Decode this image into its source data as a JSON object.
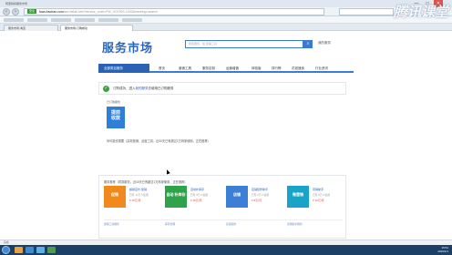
{
  "window": {
    "title": "阿里妈妈服务市场",
    "controls": [
      "—",
      "□",
      "✕"
    ]
  },
  "browser": {
    "secure_label": "安全",
    "url_domain": "fuwu.taobao.com",
    "url_rest": "/ser/detail.htm?service_code=FW_GOODS-1000&tracelog=search",
    "tabs": [
      {
        "label": "服务市场-淘宝",
        "active": false
      },
      {
        "label": "服务市场-订购成功",
        "active": true
      }
    ]
  },
  "watermark": "腾讯课堂",
  "header": {
    "logo": "服务市场",
    "logo_sub": "FUWU.TAOBAO.COM",
    "search_placeholder": "搜索服务，如:促销工具",
    "my_service": "我的服务"
  },
  "nav": {
    "category_button": "全部类目服务",
    "items": [
      "首页",
      "营销工具",
      "服务定制",
      "运营增值",
      "体验版",
      "排行榜",
      "花钱速卖",
      "行业资讯"
    ]
  },
  "notice": {
    "text_prefix": "订购成功，进入",
    "link": "我的服务",
    "text_suffix": "去使用已订购服务"
  },
  "service_card": {
    "label": "已订购服务",
    "icon_line1": "提前",
    "icon_line2": "收款",
    "description": "你可能也需要（高效营销、运营工具，近30天已有超过1万商家使用，正在推荐）"
  },
  "recommendations": {
    "title": "服务推荐（同类服务，近30天已有超过1万商家使用，正在推荐）",
    "items": [
      {
        "thumb": "促销",
        "name": "超级店长-促销",
        "meta": "已有 12万人使用",
        "price": "¥ 15元/月",
        "color": "#f08a1c"
      },
      {
        "thumb": "自动\n补库存",
        "name": "自动补库存",
        "meta": "已有 8万人使用",
        "price": "¥ 10元/月",
        "color": "#2fa34a"
      },
      {
        "thumb": "店铺",
        "name": "店铺装修助手",
        "meta": "已有 6万人使用",
        "price": "¥ 9元/月",
        "color": "#3d7fd6"
      },
      {
        "thumb": "微营销",
        "name": "营销助手",
        "meta": "已有 5万人使用",
        "price": "¥ 12元/月",
        "color": "#1aa3c8"
      }
    ],
    "footer_links": [
      "促销工具推荐",
      "库存管理",
      "店铺装修",
      "营销助手推荐"
    ]
  },
  "statusbar": "完成",
  "clock": {
    "time": "15:51",
    "date": "2016/1/1"
  }
}
